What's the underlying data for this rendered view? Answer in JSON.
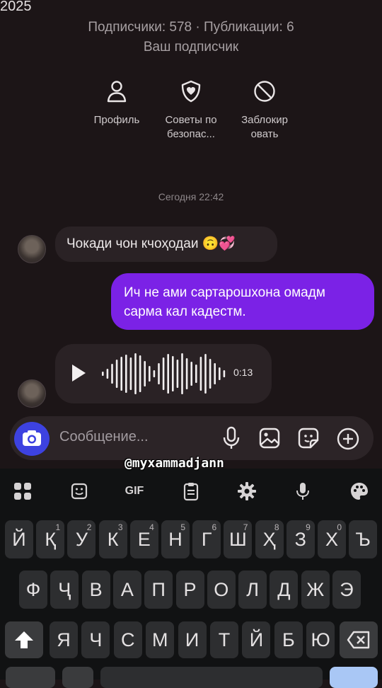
{
  "header": {
    "year": "2025",
    "stats": "Подписчики: 578 · Публикации: 6",
    "follower_label": "Ваш подписчик"
  },
  "actions": [
    {
      "icon": "person-icon",
      "label_line1": "Профиль",
      "label_line2": ""
    },
    {
      "icon": "shield-icon",
      "label_line1": "Советы по",
      "label_line2": "безопас..."
    },
    {
      "icon": "block-icon",
      "label_line1": "Заблокир",
      "label_line2": "овать"
    }
  ],
  "chat": {
    "timestamp": "Сегодня 22:42",
    "messages": [
      {
        "direction": "incoming",
        "text": "Чокади чон кчоҳодаи 🙃💞"
      },
      {
        "direction": "outgoing",
        "text_line1": "Ич не ами сартарошхона омадм",
        "text_line2": "сарма кал кадестм."
      },
      {
        "direction": "incoming",
        "type": "voice",
        "duration": "0:13"
      }
    ]
  },
  "composer": {
    "placeholder": "Сообщение..."
  },
  "watermark": "@myxammadjann",
  "keyboard": {
    "toolbar_gif": "GIF",
    "row1": [
      {
        "k": "Й",
        "n": ""
      },
      {
        "k": "Қ",
        "n": "1"
      },
      {
        "k": "У",
        "n": "2"
      },
      {
        "k": "К",
        "n": "3"
      },
      {
        "k": "Е",
        "n": "4"
      },
      {
        "k": "Н",
        "n": "5"
      },
      {
        "k": "Г",
        "n": "6"
      },
      {
        "k": "Ш",
        "n": "7"
      },
      {
        "k": "Ҳ",
        "n": "8"
      },
      {
        "k": "З",
        "n": "9"
      },
      {
        "k": "Х",
        "n": "0"
      },
      {
        "k": "Ъ",
        "n": ""
      }
    ],
    "row2": [
      "Ф",
      "Ҷ",
      "В",
      "А",
      "П",
      "Р",
      "О",
      "Л",
      "Д",
      "Ж",
      "Э"
    ],
    "row3": [
      "Я",
      "Ч",
      "С",
      "М",
      "И",
      "Т",
      "Й",
      "Б",
      "Ю"
    ]
  },
  "colors": {
    "background": "#1c1517",
    "outgoing_bubble": "#7b22e6",
    "incoming_bubble": "#2a2225",
    "camera_button": "#3d42e0"
  }
}
